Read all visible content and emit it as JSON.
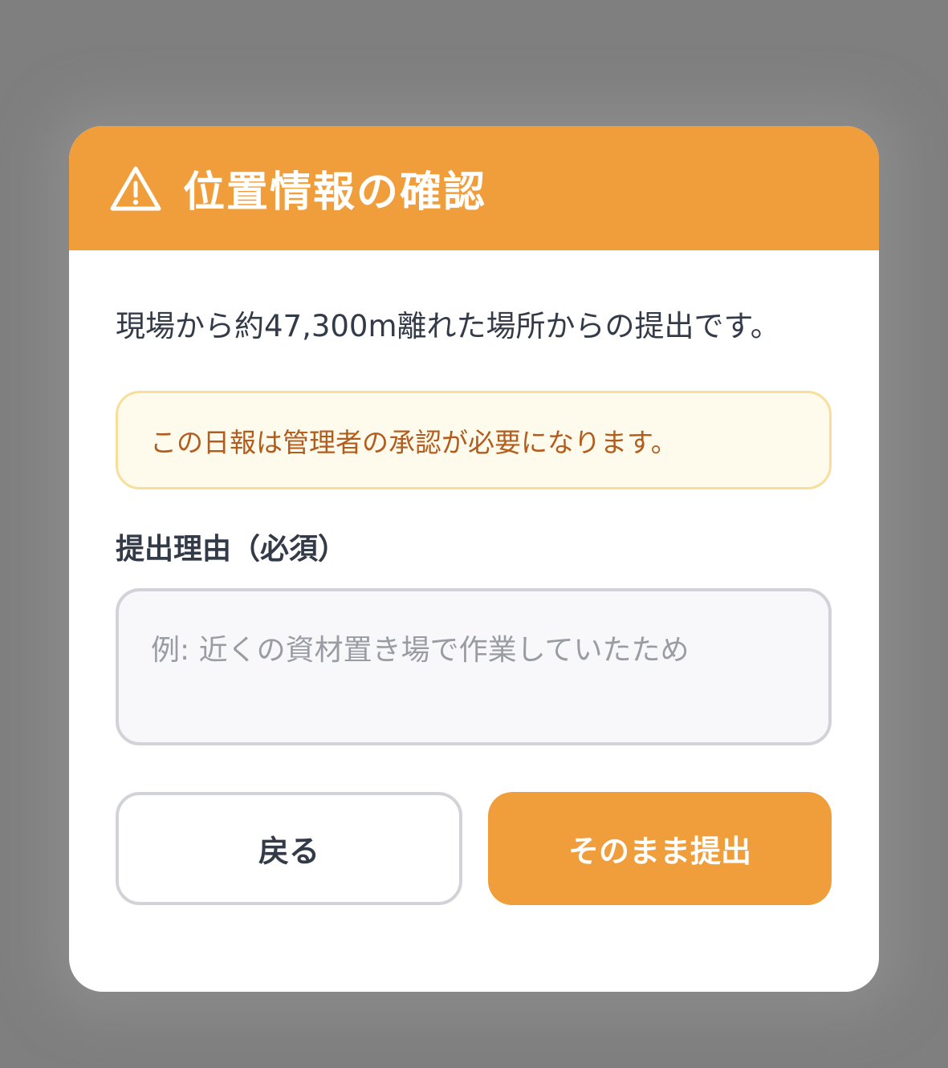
{
  "dialog": {
    "title": "位置情報の確認",
    "header_icon": "warning-triangle-icon",
    "accent_color": "#f09e3b",
    "message": "現場から約47,300m離れた場所からの提出です。",
    "notice": "この日報は管理者の承認が必要になります。",
    "reason_label": "提出理由（必須）",
    "reason_value": "",
    "reason_placeholder": "例: 近くの資材置き場で作業していたため",
    "back_button": "戻る",
    "submit_button": "そのまま提出"
  }
}
